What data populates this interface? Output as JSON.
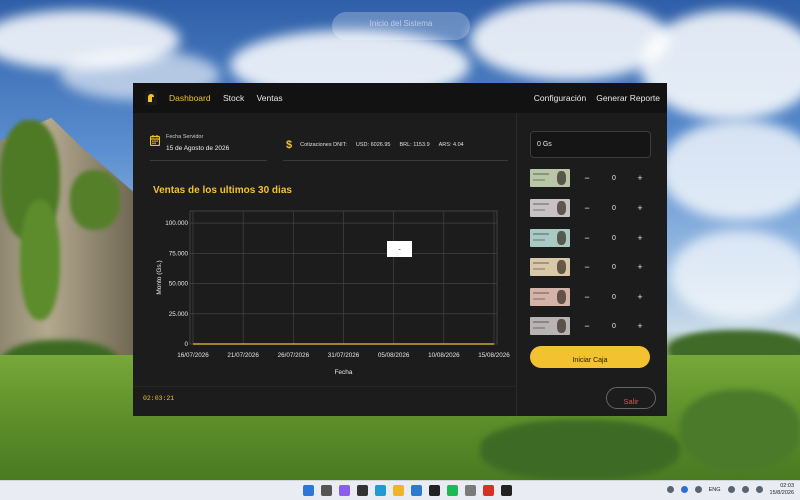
{
  "notification": {
    "text": "Inicio del Sistema"
  },
  "app": {
    "nav": {
      "dashboard": "Dashboard",
      "stock": "Stock",
      "ventas": "Ventas",
      "configuracion": "Configuración",
      "reporte": "Generar Reporte"
    },
    "server_date": {
      "label": "Fecha Servidor",
      "value": "15 de Agosto de 2026"
    },
    "rates": {
      "label": "Cotizaciones DNIT:",
      "usd": "USD: 6026.95",
      "brl": "BRL: 1153.9",
      "ars": "ARS: 4.04"
    },
    "chart_title": "Ventas de los ultimos 30 dias",
    "clock": "02:03:21",
    "total": "0 Gs",
    "bills": [
      {
        "count": "0",
        "minus": "−",
        "plus": "+",
        "color": "#b9c7a8"
      },
      {
        "count": "0",
        "minus": "−",
        "plus": "+",
        "color": "#c9c2c4"
      },
      {
        "count": "0",
        "minus": "−",
        "plus": "+",
        "color": "#a9c9c4"
      },
      {
        "count": "0",
        "minus": "−",
        "plus": "+",
        "color": "#d9c9a8"
      },
      {
        "count": "0",
        "minus": "−",
        "plus": "+",
        "color": "#d4b3a8"
      },
      {
        "count": "0",
        "minus": "−",
        "plus": "+",
        "color": "#b9b3b3"
      }
    ],
    "iniciar_button": "Iniciar Caja",
    "salir_button": "Salir",
    "accent": "#f2c230"
  },
  "chart_data": {
    "type": "line",
    "title": "Ventas de los ultimos 30 dias",
    "xlabel": "Fecha",
    "ylabel": "Monto (Gs.)",
    "x_ticks": [
      "16/07/2026",
      "21/07/2026",
      "26/07/2026",
      "31/07/2026",
      "05/08/2026",
      "10/08/2026",
      "15/08/2026"
    ],
    "y_ticks": [
      "0",
      "25.000",
      "50.000",
      "75.000",
      "100.000"
    ],
    "ylim": [
      0,
      110000
    ],
    "series": [
      {
        "values": [
          0,
          0,
          0,
          0,
          0,
          0,
          0
        ]
      }
    ],
    "tooltip": "-",
    "grid": true
  },
  "taskbar": {
    "lang": "ENG",
    "time": "02:03",
    "date": "15/8/2026",
    "icons": [
      "windows-icon",
      "search-icon",
      "copilot-icon",
      "terminal-icon",
      "edge-icon",
      "explorer-icon",
      "vscode-icon",
      "notion-icon",
      "spotify-icon",
      "mail-icon",
      "chrome-icon",
      "app-icon"
    ]
  }
}
